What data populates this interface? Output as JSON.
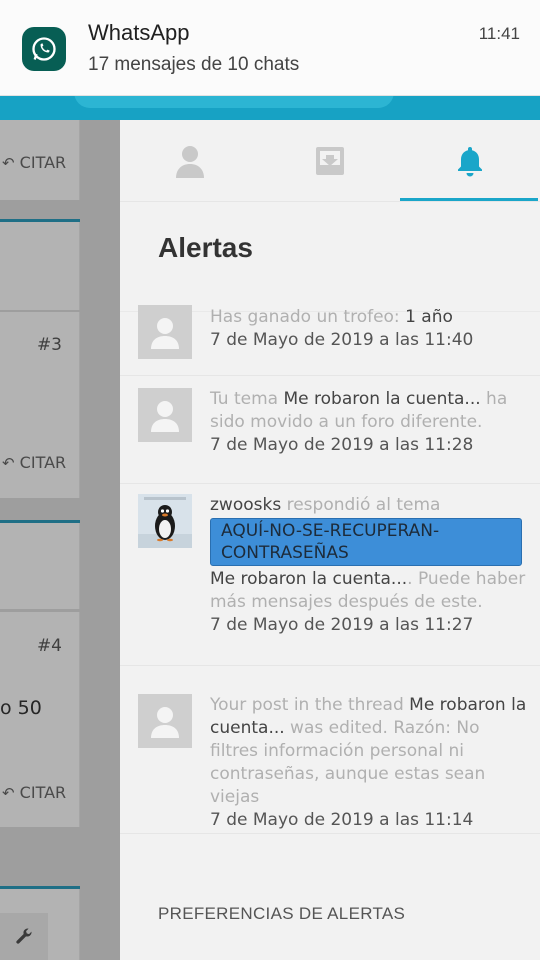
{
  "notification": {
    "app": "WhatsApp",
    "summary": "17 mensajes de 10 chats",
    "time": "11:41",
    "icon": "whatsapp-icon"
  },
  "background": {
    "cite_label": "CITAR",
    "post_numbers": [
      "#3",
      "#4"
    ],
    "snippet": "o 50"
  },
  "tabs": [
    {
      "name": "profile",
      "icon": "user-icon"
    },
    {
      "name": "inbox",
      "icon": "inbox-icon"
    },
    {
      "name": "alerts",
      "icon": "bell-icon",
      "active": true
    }
  ],
  "alerts_title": "Alertas",
  "alerts": [
    {
      "parts": [
        {
          "t": "Has ganado un trofeo: ",
          "hl": false
        },
        {
          "t": "1 año",
          "hl": true
        }
      ],
      "date": "7 de Mayo de 2019 a las 11:40"
    },
    {
      "parts": [
        {
          "t": "Tu tema ",
          "hl": false
        },
        {
          "t": "Me robaron la cuenta...",
          "hl": true
        },
        {
          "t": " ha sido movido a un foro diferente.",
          "hl": false
        }
      ],
      "date": "7 de Mayo de 2019 a las 11:28"
    },
    {
      "user": "zwoosks",
      "action": " respondió al tema",
      "tag": "AQUÍ-NO-SE-RECUPERAN-CONTRASEÑAS",
      "thread": "Me robaron la cuenta...",
      "note": ". Puede haber más mensajes después de este.",
      "date": "7 de Mayo de 2019 a las 11:27"
    },
    {
      "parts": [
        {
          "t": "Your post in the thread ",
          "hl": false
        },
        {
          "t": "Me robaron la cuenta...",
          "hl": true
        },
        {
          "t": " was edited. Razón: No filtres información personal ni contraseñas, aunque estas sean viejas",
          "hl": false
        }
      ],
      "date": "7 de Mayo de 2019 a las 11:14"
    }
  ],
  "preferences_label": "PREFERENCIAS DE ALERTAS",
  "colors": {
    "accent": "#1aa6c9",
    "tag_bg": "#3d8ed8",
    "whatsapp": "#075e54"
  }
}
